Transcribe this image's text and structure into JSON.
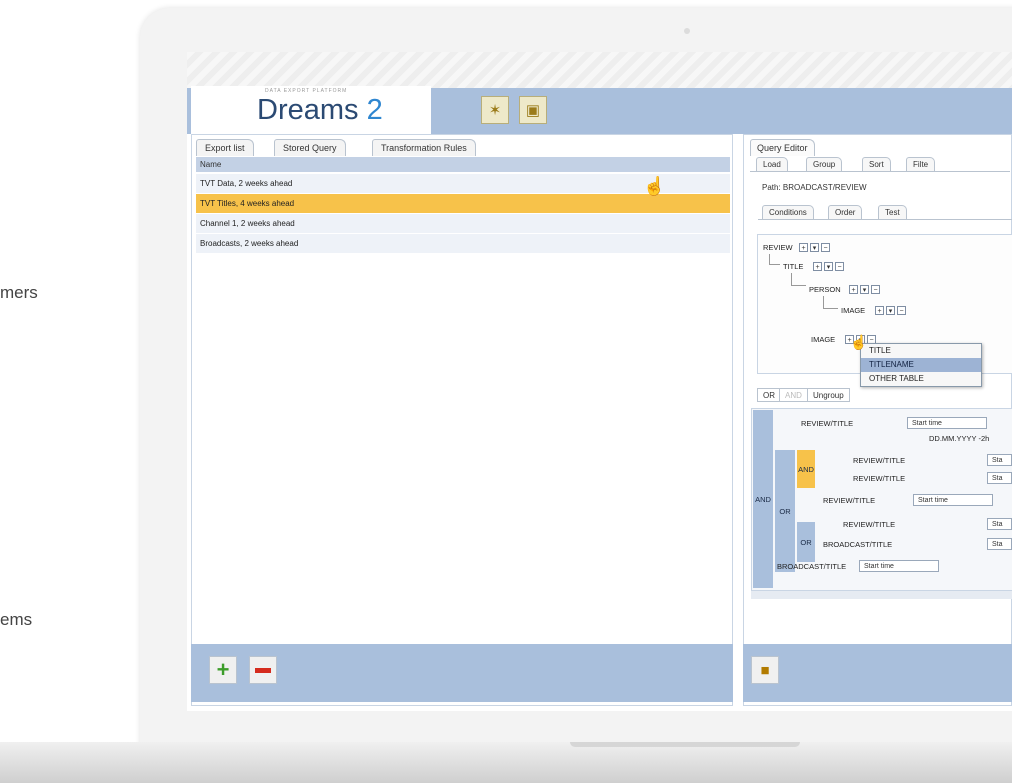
{
  "side_texts": [
    "mers",
    "ems"
  ],
  "logo": {
    "subtitle": "DATA EXPORT PLATFORM",
    "name": "Dreams",
    "version": "2"
  },
  "toolbar": {
    "btn1_icon": "export-search-icon",
    "btn2_icon": "query-document-icon"
  },
  "left_tabs": [
    "Export list",
    "Stored Query",
    "Transformation Rules"
  ],
  "list": {
    "header": "Name",
    "rows": [
      "TVT Data, 2 weeks ahead",
      "TVT Titles, 4 weeks ahead",
      "Channel 1, 2 weeks ahead",
      "Broadcasts, 2 weeks ahead"
    ],
    "selected_index": 1
  },
  "left_footer": {
    "add_icon": "plus-icon",
    "remove_icon": "minus-icon"
  },
  "query_editor": {
    "title": "Query Editor",
    "tabs": [
      "Load",
      "Group",
      "Sort",
      "Filte"
    ],
    "path_label": "Path:",
    "path_value": "BROADCAST/REVIEW",
    "subtabs": [
      "Conditions",
      "Order",
      "Test"
    ],
    "tree": [
      "REVIEW",
      "TITLE",
      "PERSON",
      "IMAGE",
      "IMAGE"
    ],
    "dropdown": [
      "TITLE",
      "TITLENAME",
      "OTHER TABLE"
    ],
    "dropdown_selected": 1,
    "logic_buttons": [
      "OR",
      "AND",
      "Ungroup"
    ],
    "conditions": {
      "and_label": "AND",
      "or_label": "OR",
      "rows": [
        {
          "field": "REVIEW/TITLE",
          "op": "Start time"
        },
        {
          "field": "",
          "op": "DD.MM.YYYY -2h"
        },
        {
          "field": "REVIEW/TITLE",
          "op": "Sta"
        },
        {
          "field": "REVIEW/TITLE",
          "op": "Sta"
        },
        {
          "field": "REVIEW/TITLE",
          "op": "Start time"
        },
        {
          "field": "REVIEW/TITLE",
          "op": "Sta"
        },
        {
          "field": "BROADCAST/TITLE",
          "op": "Sta"
        },
        {
          "field": "BROADCAST/TITLE",
          "op": "Start time"
        }
      ]
    },
    "save_icon": "save-icon"
  }
}
